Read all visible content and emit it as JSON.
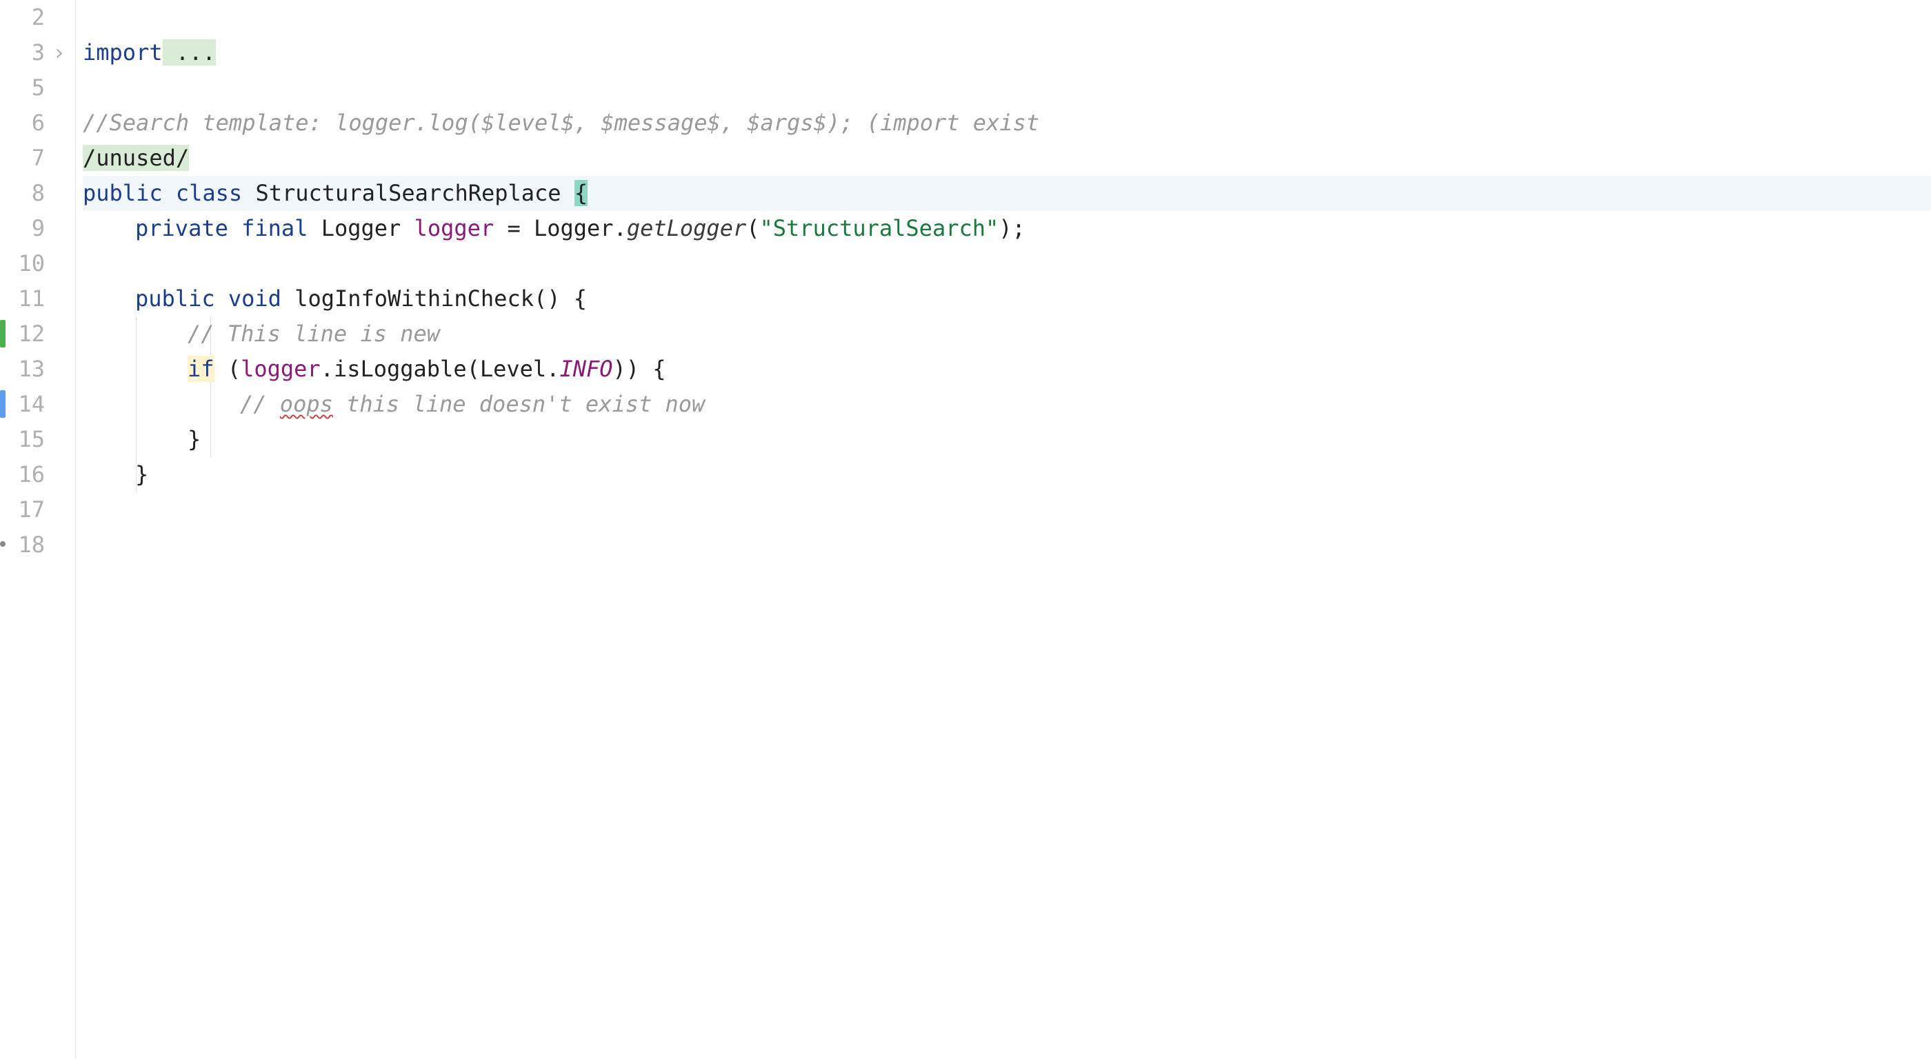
{
  "line_height": 51,
  "first_top": 0,
  "lines": [
    {
      "num": "2"
    },
    {
      "num": "3",
      "fold": true
    },
    {
      "num": "5"
    },
    {
      "num": "6"
    },
    {
      "num": "7"
    },
    {
      "num": "8",
      "current": true
    },
    {
      "num": "9"
    },
    {
      "num": "10"
    },
    {
      "num": "11"
    },
    {
      "num": "12",
      "marker": "green"
    },
    {
      "num": "13"
    },
    {
      "num": "14",
      "marker": "blue"
    },
    {
      "num": "15"
    },
    {
      "num": "16"
    },
    {
      "num": "17"
    },
    {
      "num": "18",
      "dot": true
    }
  ],
  "code": {
    "l3_import": "import",
    "l3_dots": " ...",
    "l6_comment": "//Search template: logger.log($level$, $message$, $args$); (import exist",
    "l7_unused": "/unused/",
    "l8_public": "public",
    "l8_class": "class",
    "l8_name": "StructuralSearchReplace ",
    "l8_brace": "{",
    "l9_private": "private",
    "l9_final": "final",
    "l9_type": "Logger ",
    "l9_logger": "logger",
    "l9_eq": " = Logger.",
    "l9_getlogger": "getLogger",
    "l9_paren": "(",
    "l9_str": "\"StructuralSearch\"",
    "l9_end": ");",
    "l11_public": "public",
    "l11_void": "void",
    "l11_method": "logInfoWithinCheck() {",
    "l12_comment": "// This line is new",
    "l13_if": "if",
    "l13_open": " (",
    "l13_logger": "logger",
    "l13_dot": ".isLoggable(Level.",
    "l13_info": "INFO",
    "l13_close": ")) {",
    "l14_comment_pre": "// ",
    "l14_oops": "oops",
    "l14_comment_post": " this line doesn't exist now",
    "l15_brace": "}",
    "l16_brace": "}"
  }
}
